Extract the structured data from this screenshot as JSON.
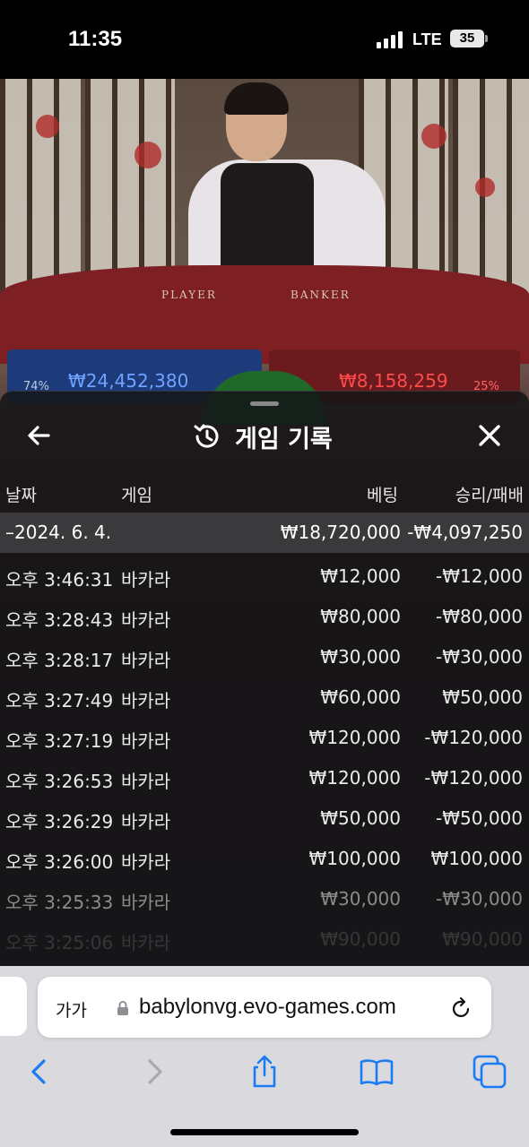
{
  "status_bar": {
    "time": "11:35",
    "network": "LTE",
    "battery": "35"
  },
  "game_table": {
    "player_label": "PLAYER",
    "banker_label": "BANKER",
    "player_total": "₩24,452,380",
    "banker_total": "₩8,158,259",
    "player_pct": "74%",
    "banker_pct": "25%"
  },
  "history": {
    "title": "게임 기록",
    "columns": {
      "date": "날짜",
      "game": "게임",
      "bet": "베팅",
      "result": "승리/패배"
    },
    "day": {
      "date": "–2024. 6. 4.",
      "bet": "₩18,720,000",
      "result": "-₩4,097,250"
    },
    "rows": [
      {
        "time": "오후 3:46:31",
        "game": "바카라",
        "bet": "₩12,000",
        "result": "-₩12,000"
      },
      {
        "time": "오후 3:28:43",
        "game": "바카라",
        "bet": "₩80,000",
        "result": "-₩80,000"
      },
      {
        "time": "오후 3:28:17",
        "game": "바카라",
        "bet": "₩30,000",
        "result": "-₩30,000"
      },
      {
        "time": "오후 3:27:49",
        "game": "바카라",
        "bet": "₩60,000",
        "result": "₩50,000"
      },
      {
        "time": "오후 3:27:19",
        "game": "바카라",
        "bet": "₩120,000",
        "result": "-₩120,000"
      },
      {
        "time": "오후 3:26:53",
        "game": "바카라",
        "bet": "₩120,000",
        "result": "-₩120,000"
      },
      {
        "time": "오후 3:26:29",
        "game": "바카라",
        "bet": "₩50,000",
        "result": "-₩50,000"
      },
      {
        "time": "오후 3:26:00",
        "game": "바카라",
        "bet": "₩100,000",
        "result": "₩100,000"
      },
      {
        "time": "오후 3:25:33",
        "game": "바카라",
        "bet": "₩30,000",
        "result": "-₩30,000"
      },
      {
        "time": "오후 3:25:06",
        "game": "바카라",
        "bet": "₩90,000",
        "result": "₩90,000"
      }
    ]
  },
  "browser": {
    "text_size_label": "가가",
    "url": "babylonvg.evo-games.com"
  },
  "icons": {
    "back": "arrow-left-icon",
    "close": "close-icon",
    "history": "history-icon",
    "lock": "lock-icon",
    "reload": "reload-icon",
    "nav_back": "chevron-left-icon",
    "nav_forward": "chevron-right-icon",
    "share": "share-icon",
    "bookmarks": "book-icon",
    "tabs": "tabs-icon"
  },
  "colors": {
    "accent_blue": "#1a7cf5",
    "player_blue": "#6fa3ff",
    "banker_red": "#ff4a4a"
  }
}
